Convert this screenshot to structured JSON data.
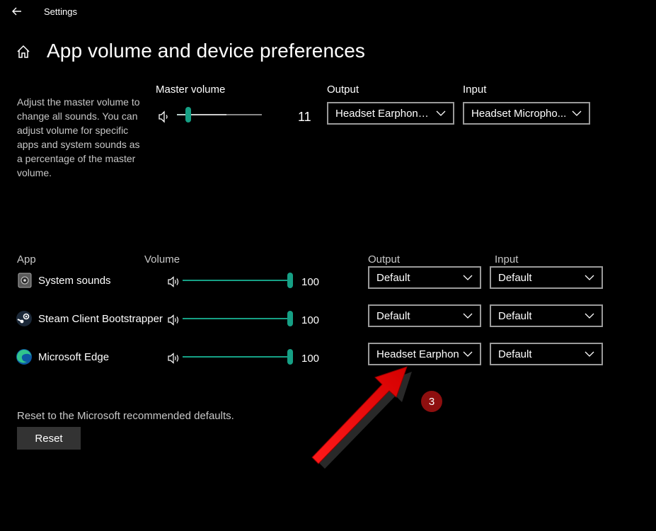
{
  "window": {
    "title": "Settings"
  },
  "page": {
    "title": "App volume and device preferences",
    "description": "Adjust the master volume to change all sounds. You can adjust volume for specific apps and system sounds as a percentage of the master volume."
  },
  "master": {
    "label": "Master volume",
    "value": "11",
    "level_fraction": 0.11,
    "output_label": "Output",
    "output_value": "Headset Earphone...",
    "input_label": "Input",
    "input_value": "Headset Micropho..."
  },
  "columns": {
    "app": "App",
    "volume": "Volume",
    "output": "Output",
    "input": "Input"
  },
  "apps": [
    {
      "name": "System sounds",
      "icon": "system-sounds-icon",
      "volume": "100",
      "level_fraction": 1.0,
      "output": "Default",
      "input": "Default"
    },
    {
      "name": "Steam Client Bootstrapper",
      "icon": "steam-icon",
      "volume": "100",
      "level_fraction": 1.0,
      "output": "Default",
      "input": "Default"
    },
    {
      "name": "Microsoft Edge",
      "icon": "edge-icon",
      "volume": "100",
      "level_fraction": 1.0,
      "output": "Headset Earphone",
      "input": "Default"
    }
  ],
  "reset": {
    "note": "Reset to the Microsoft recommended defaults.",
    "button": "Reset"
  },
  "annotation": {
    "badge": "3"
  },
  "colors": {
    "accent": "#16a085",
    "arrow": "#e01010",
    "badge": "#8e0f0f"
  }
}
